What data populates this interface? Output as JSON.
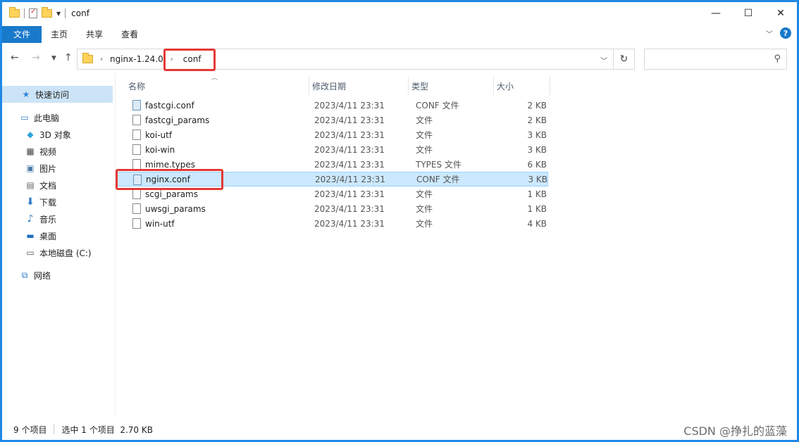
{
  "window": {
    "title": "conf",
    "controls": {
      "minimize": "—",
      "maximize": "☐",
      "close": "✕"
    }
  },
  "ribbon": {
    "tabs": [
      "文件",
      "主页",
      "共享",
      "查看"
    ],
    "help": "?"
  },
  "address": {
    "crumbs": [
      "nginx-1.24.0",
      "conf"
    ],
    "search_placeholder": ""
  },
  "sidebar": {
    "items": [
      {
        "label": "快速访问",
        "icon": "star-icon"
      },
      {
        "label": "此电脑",
        "icon": "computer-icon"
      },
      {
        "label": "3D 对象",
        "icon": "3d-objects-icon"
      },
      {
        "label": "视频",
        "icon": "video-icon"
      },
      {
        "label": "图片",
        "icon": "pictures-icon"
      },
      {
        "label": "文档",
        "icon": "documents-icon"
      },
      {
        "label": "下载",
        "icon": "download-icon"
      },
      {
        "label": "音乐",
        "icon": "music-icon"
      },
      {
        "label": "桌面",
        "icon": "desktop-icon"
      },
      {
        "label": "本地磁盘 (C:)",
        "icon": "drive-icon"
      },
      {
        "label": "网络",
        "icon": "network-icon"
      }
    ]
  },
  "columns": [
    "名称",
    "修改日期",
    "类型",
    "大小"
  ],
  "files": [
    {
      "name": "fastcgi.conf",
      "date": "2023/4/11 23:31",
      "type": "CONF 文件",
      "size": "2 KB"
    },
    {
      "name": "fastcgi_params",
      "date": "2023/4/11 23:31",
      "type": "文件",
      "size": "2 KB"
    },
    {
      "name": "koi-utf",
      "date": "2023/4/11 23:31",
      "type": "文件",
      "size": "3 KB"
    },
    {
      "name": "koi-win",
      "date": "2023/4/11 23:31",
      "type": "文件",
      "size": "3 KB"
    },
    {
      "name": "mime.types",
      "date": "2023/4/11 23:31",
      "type": "TYPES 文件",
      "size": "6 KB"
    },
    {
      "name": "nginx.conf",
      "date": "2023/4/11 23:31",
      "type": "CONF 文件",
      "size": "3 KB"
    },
    {
      "name": "scgi_params",
      "date": "2023/4/11 23:31",
      "type": "文件",
      "size": "1 KB"
    },
    {
      "name": "uwsgi_params",
      "date": "2023/4/11 23:31",
      "type": "文件",
      "size": "1 KB"
    },
    {
      "name": "win-utf",
      "date": "2023/4/11 23:31",
      "type": "文件",
      "size": "4 KB"
    }
  ],
  "status": {
    "count": "9 个项目",
    "selection": "选中 1 个项目  2.70 KB"
  },
  "watermark": "CSDN @挣扎的蓝藻",
  "colors": {
    "highlight_box": "#e53935",
    "selection": "#cce8ff",
    "file_tab": "#1979ca"
  }
}
